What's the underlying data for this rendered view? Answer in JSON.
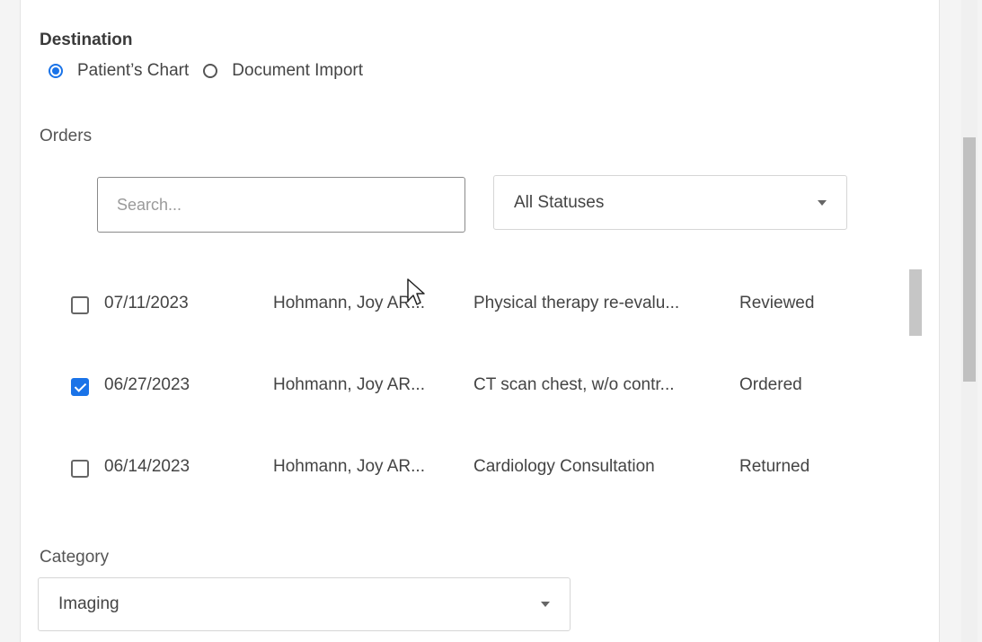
{
  "destination": {
    "label": "Destination",
    "options": [
      {
        "label": "Patient’s Chart",
        "selected": true
      },
      {
        "label": "Document Import",
        "selected": false
      }
    ]
  },
  "orders": {
    "label": "Orders",
    "search_placeholder": "Search...",
    "status_filter": "All Statuses",
    "rows": [
      {
        "checked": false,
        "date": "07/11/2023",
        "provider": "Hohmann, Joy AR...",
        "description": "Physical therapy re-evalu...",
        "status": "Reviewed"
      },
      {
        "checked": true,
        "date": "06/27/2023",
        "provider": "Hohmann, Joy AR...",
        "description": "CT scan chest, w/o contr...",
        "status": "Ordered"
      },
      {
        "checked": false,
        "date": "06/14/2023",
        "provider": "Hohmann, Joy AR...",
        "description": "Cardiology Consultation",
        "status": "Returned"
      }
    ]
  },
  "category": {
    "label": "Category",
    "value": "Imaging"
  },
  "colors": {
    "accent": "#1a73e8"
  }
}
